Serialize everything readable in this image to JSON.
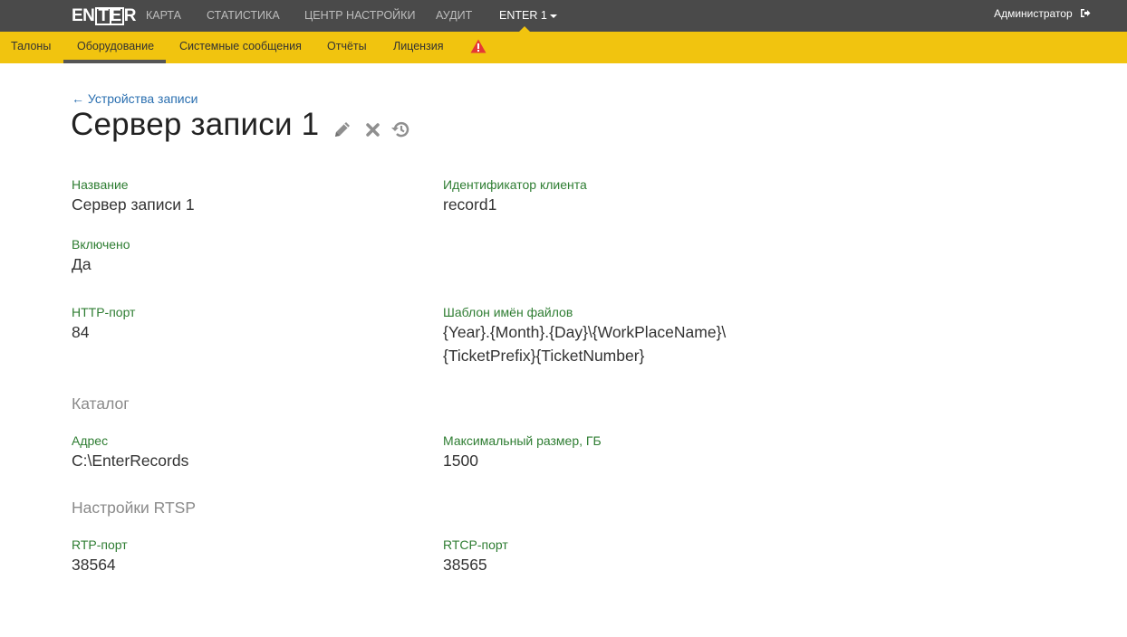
{
  "topnav": {
    "logo_text": "ENTER",
    "items": [
      {
        "label": "КАРТА"
      },
      {
        "label": "СТАТИСТИКА"
      },
      {
        "label": "ЦЕНТР НАСТРОЙКИ"
      },
      {
        "label": "АУДИТ"
      },
      {
        "label": "ENTER 1"
      }
    ],
    "user": "Администратор"
  },
  "subnav": {
    "items": [
      {
        "label": "Талоны"
      },
      {
        "label": "Оборудование"
      },
      {
        "label": "Системные сообщения"
      },
      {
        "label": "Отчёты"
      },
      {
        "label": "Лицензия"
      }
    ],
    "active": "Оборудование"
  },
  "page": {
    "back_link": "← Устройства записи",
    "title": "Сервер записи 1"
  },
  "fields": {
    "name": {
      "label": "Название",
      "value": "Сервер записи 1"
    },
    "client_id": {
      "label": "Идентификатор клиента",
      "value": "record1"
    },
    "enabled": {
      "label": "Включено",
      "value": "Да"
    },
    "http_port": {
      "label": "HTTP-порт",
      "value": "84"
    },
    "filename_template": {
      "label": "Шаблон имён файлов",
      "value_line1": "{Year}.{Month}.{Day}\\{WorkPlaceName}\\",
      "value_line2": "{TicketPrefix}{TicketNumber}"
    }
  },
  "catalog": {
    "heading": "Каталог",
    "address": {
      "label": "Адрес",
      "value": "C:\\EnterRecords"
    },
    "max_size": {
      "label": "Максимальный размер, ГБ",
      "value": "1500"
    }
  },
  "rtsp": {
    "heading": "Настройки RTSP",
    "rtp_port": {
      "label": "RTP-порт",
      "value": "38564"
    },
    "rtcp_port": {
      "label": "RTCP-порт",
      "value": "38565"
    }
  },
  "colors": {
    "topbar": "#4a4a4a",
    "subbar": "#f1c40f",
    "label_green": "#2e7d32",
    "link_blue": "#2a6fb0",
    "warning_red": "#e53935"
  },
  "icons": [
    "logout-icon",
    "warning-icon",
    "edit-icon",
    "delete-icon",
    "history-icon",
    "caret-down-icon"
  ]
}
